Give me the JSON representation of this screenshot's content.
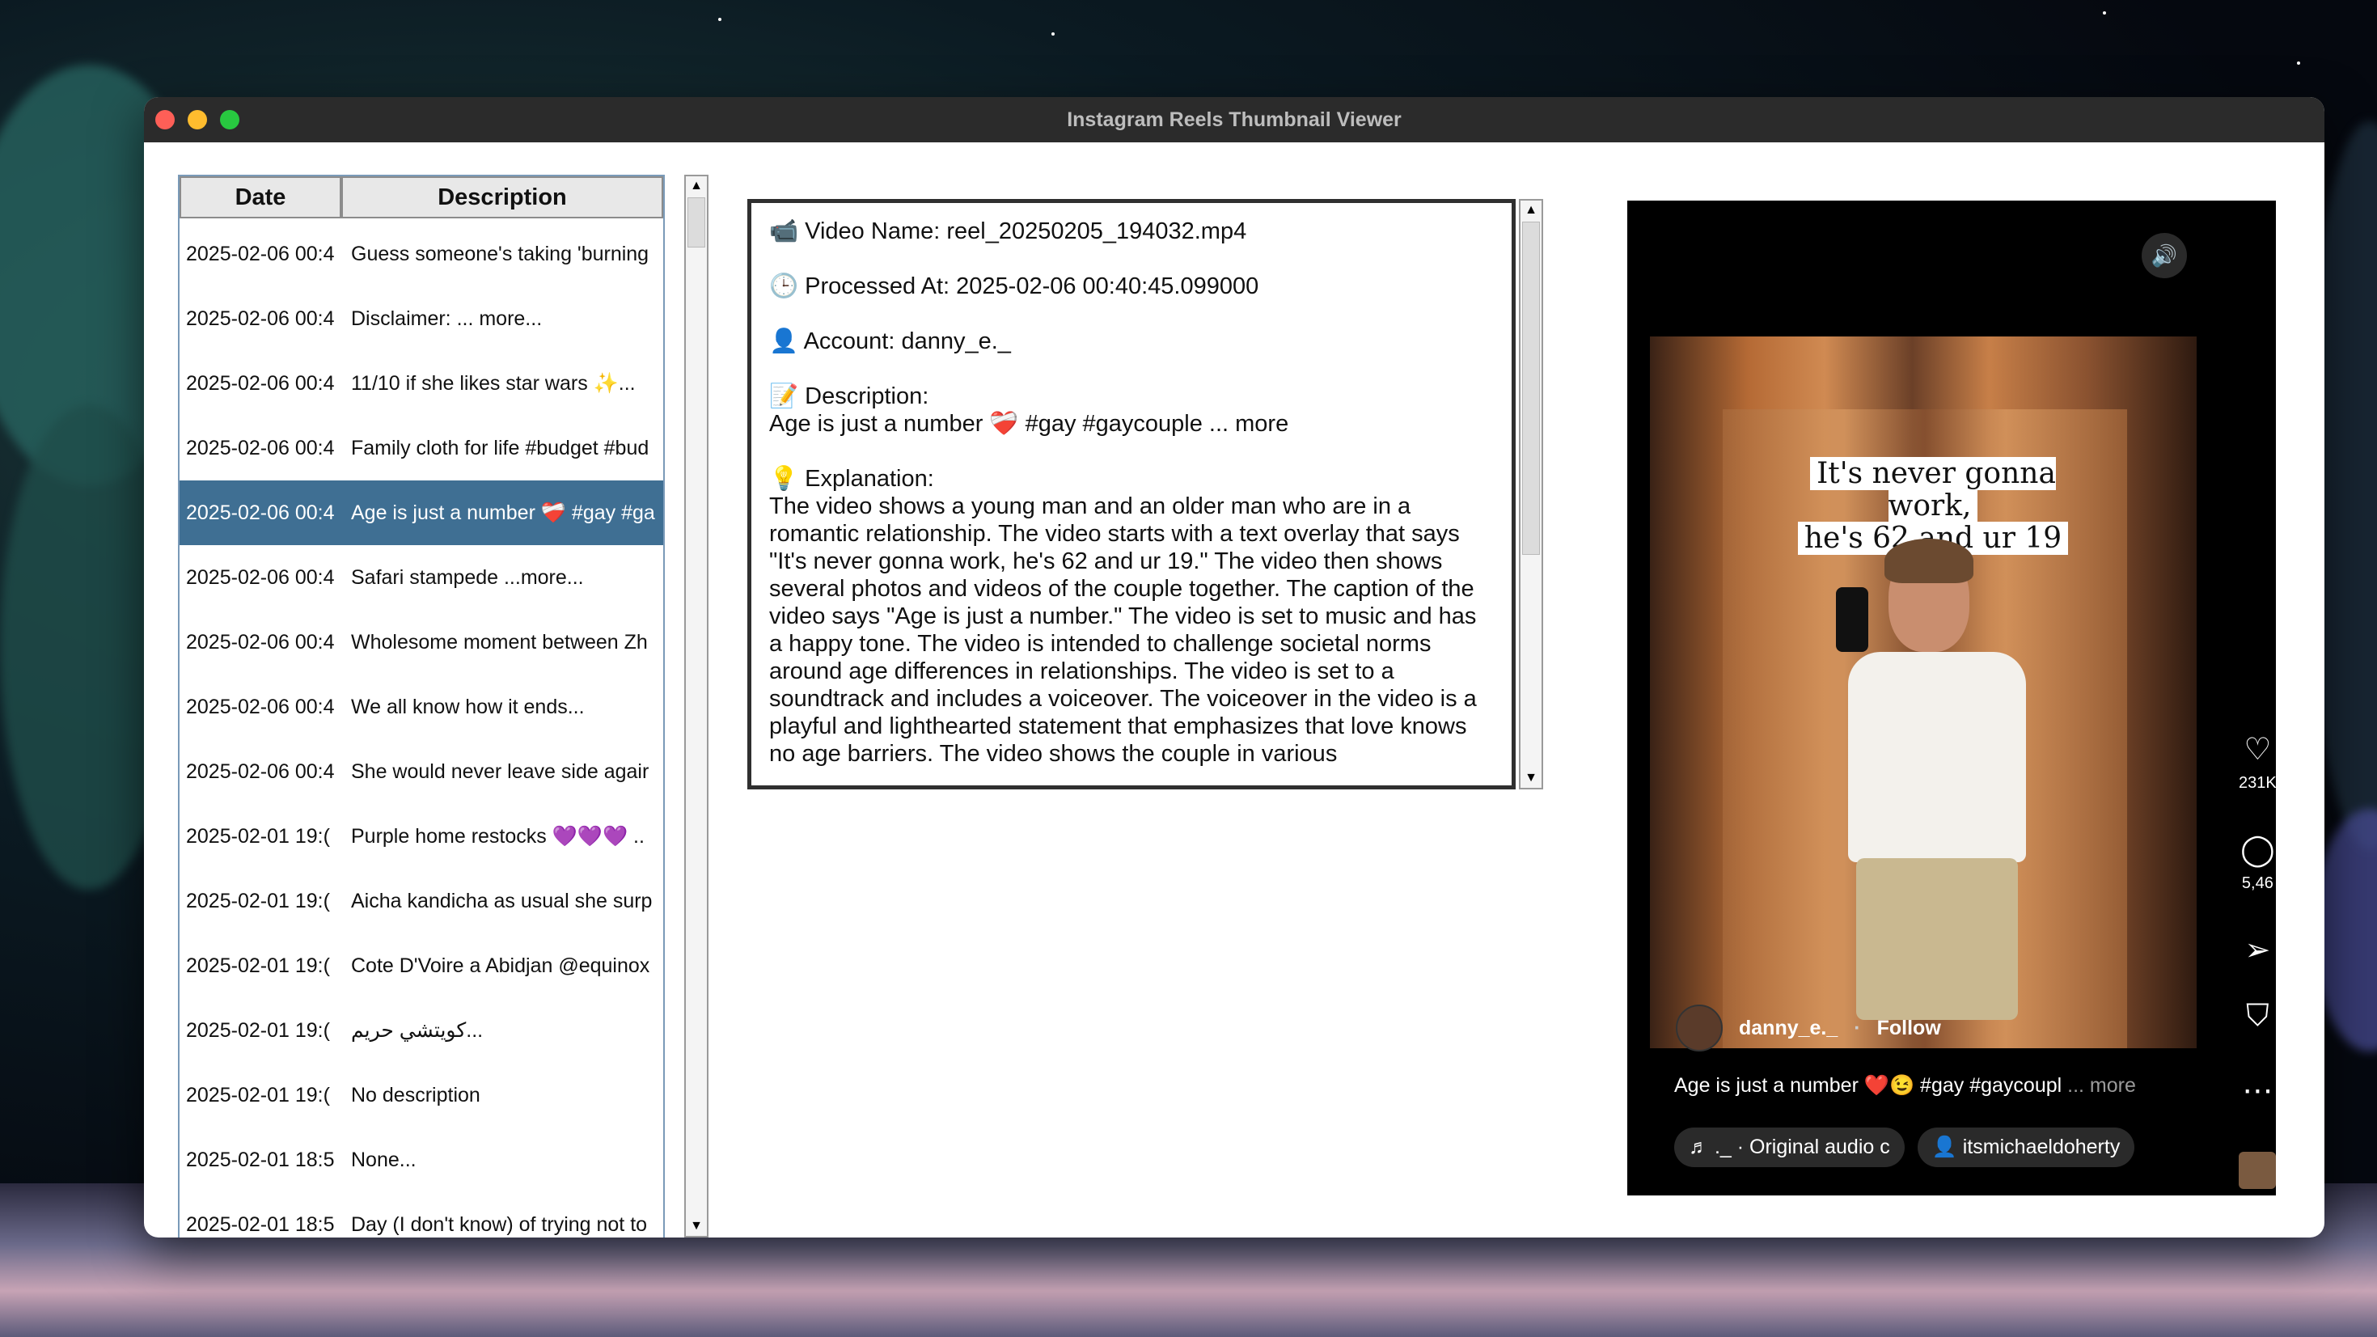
{
  "window": {
    "title": "Instagram Reels Thumbnail Viewer"
  },
  "table": {
    "headers": {
      "date": "Date",
      "description": "Description"
    },
    "rows": [
      {
        "date": "2025-02-06 00:4",
        "desc": "Guess someone's taking 'burning"
      },
      {
        "date": "2025-02-06 00:4",
        "desc": "Disclaimer: ... more..."
      },
      {
        "date": "2025-02-06 00:4",
        "desc": "11/10 if she likes star wars ✨..."
      },
      {
        "date": "2025-02-06 00:4",
        "desc": "Family cloth for life #budget #bud"
      },
      {
        "date": "2025-02-06 00:4",
        "desc": "Age is just a number ❤️‍🩹 #gay #ga"
      },
      {
        "date": "2025-02-06 00:4",
        "desc": "Safari stampede ...more..."
      },
      {
        "date": "2025-02-06 00:4",
        "desc": "Wholesome moment between Zh"
      },
      {
        "date": "2025-02-06 00:4",
        "desc": "We all know how it ends..."
      },
      {
        "date": "2025-02-06 00:4",
        "desc": "She would never leave side agair"
      },
      {
        "date": "2025-02-01 19:(",
        "desc": "Purple home restocks 💜💜💜 .."
      },
      {
        "date": "2025-02-01 19:(",
        "desc": "Aicha kandicha as usual she surp"
      },
      {
        "date": "2025-02-01 19:(",
        "desc": "Cote D'Voire a Abidjan @equinox"
      },
      {
        "date": "2025-02-01 19:(",
        "desc": "كويتشي حريم..."
      },
      {
        "date": "2025-02-01 19:(",
        "desc": "No description"
      },
      {
        "date": "2025-02-01 18:5",
        "desc": "None..."
      },
      {
        "date": "2025-02-01 18:5",
        "desc": "Day (I don't know) of trying not to"
      }
    ],
    "selected_index": 4
  },
  "details": {
    "video_name": "📹 Video Name: reel_20250205_194032.mp4",
    "processed_at": "🕒 Processed At: 2025-02-06 00:40:45.099000",
    "account": "👤 Account: danny_e._",
    "description_label": "📝 Description:",
    "description": "Age is just a number ❤️‍🩹 #gay #gaycouple ... more",
    "explanation_label": "💡 Explanation:",
    "explanation": "The video shows a young man and an older man who are in a romantic relationship. The video starts with a text overlay that says \"It's never gonna work, he's 62 and ur 19.\" The video then shows several photos and videos of the couple together. The caption of the video says \"Age is just a number.\" The video is set to music and has a happy tone. The video is intended to challenge societal norms around age differences in relationships. The video is set to a soundtrack and includes a voiceover. The voiceover in the video is a playful and lighthearted statement that emphasizes that love knows no age barriers.  The video shows the couple in various"
  },
  "thumbnail": {
    "overlay_line1": "It's never gonna work,",
    "overlay_line2": "he's 62 and ur 19",
    "username": "danny_e._",
    "follow": "Follow",
    "caption": "Age is just a number ❤️😉 #gay #gaycoupl",
    "caption_more": "... more",
    "audio_chip": "♬ ._ · Original audio  c",
    "collab_chip": "👤 itsmichaeldoherty",
    "likes": "231K",
    "comments": "5,46",
    "icons": [
      "volume-icon",
      "heart-icon",
      "comment-icon",
      "share-icon",
      "bookmark-icon",
      "more-icon"
    ]
  },
  "colors": {
    "selection": "#3f6f93",
    "titlebar": "#2b2b2b"
  }
}
